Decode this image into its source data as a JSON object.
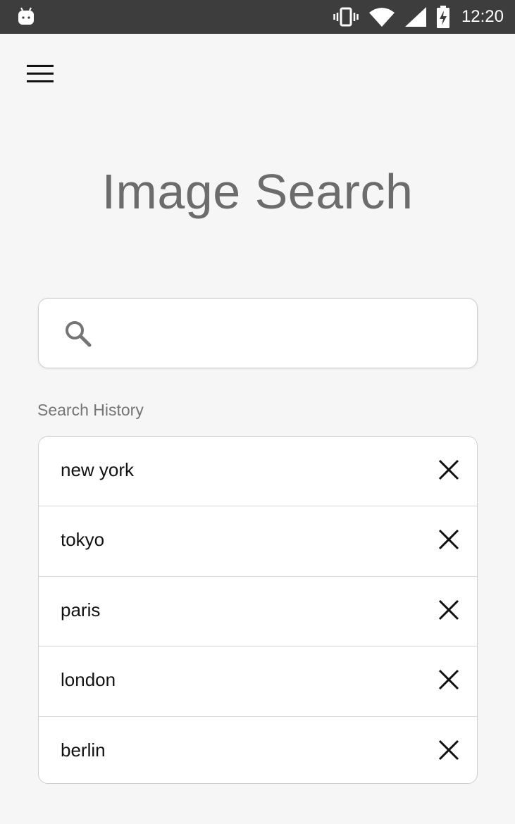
{
  "status_bar": {
    "time": "12:20",
    "icons": [
      "android-icon",
      "vibrate-icon",
      "wifi-icon",
      "signal-icon",
      "battery-charging-icon"
    ]
  },
  "header": {
    "menu_icon": "hamburger-menu-icon"
  },
  "main": {
    "title": "Image Search",
    "search": {
      "icon": "search-icon",
      "value": "",
      "placeholder": ""
    },
    "history": {
      "label": "Search History",
      "items": [
        {
          "text": "new york"
        },
        {
          "text": "tokyo"
        },
        {
          "text": "paris"
        },
        {
          "text": "london"
        },
        {
          "text": "berlin"
        }
      ]
    }
  },
  "colors": {
    "status_bar_bg": "#3d3d3d",
    "page_bg": "#f6f6f6",
    "title_text": "#6c6c6c",
    "border": "#cfcfcf"
  }
}
